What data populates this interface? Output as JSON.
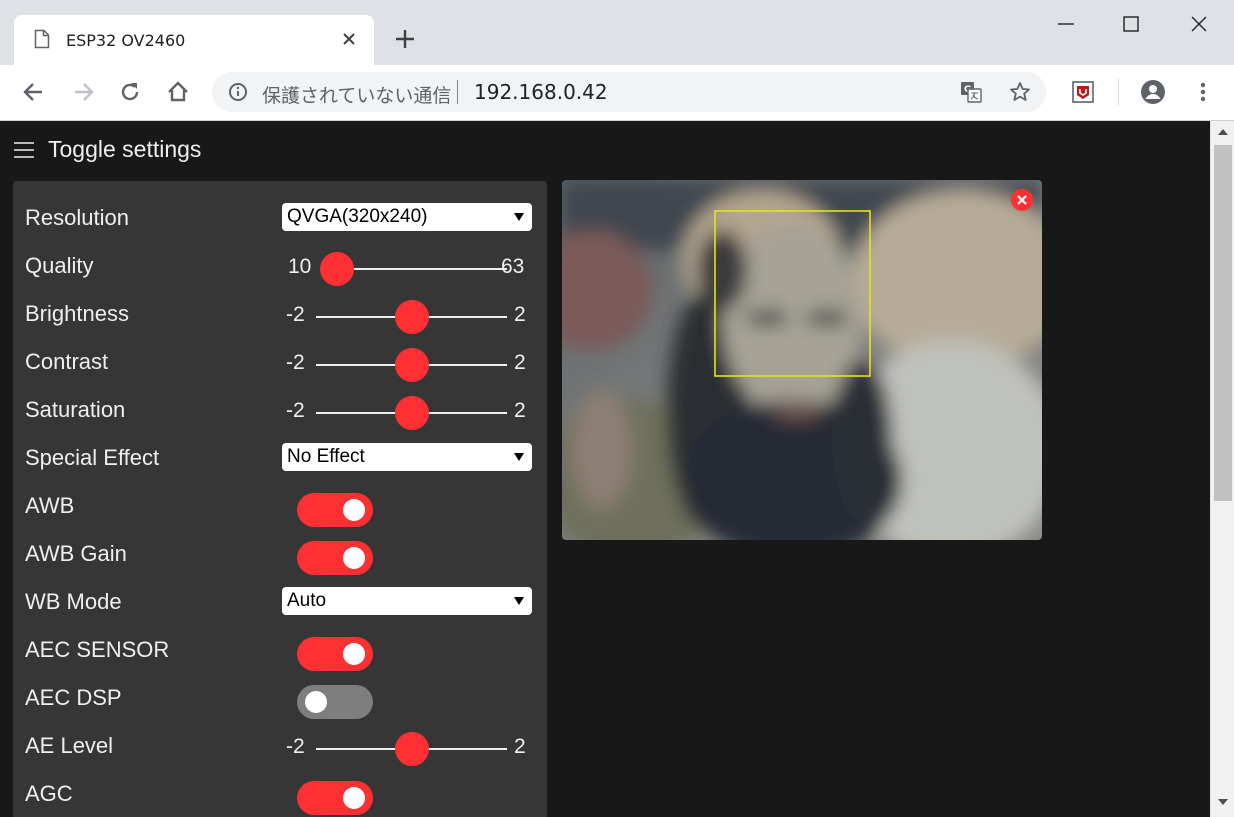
{
  "browser": {
    "tab_title": "ESP32 OV2460",
    "security_text": "保護されていない通信",
    "url": "192.168.0.42"
  },
  "page": {
    "toggle_label": "Toggle settings"
  },
  "settings": {
    "resolution": {
      "label": "Resolution",
      "value": "QVGA(320x240)"
    },
    "quality": {
      "label": "Quality",
      "min": "10",
      "max": "63",
      "value": 10
    },
    "brightness": {
      "label": "Brightness",
      "min": "-2",
      "max": "2",
      "value": 0
    },
    "contrast": {
      "label": "Contrast",
      "min": "-2",
      "max": "2",
      "value": 0
    },
    "saturation": {
      "label": "Saturation",
      "min": "-2",
      "max": "2",
      "value": 0
    },
    "special_effect": {
      "label": "Special Effect",
      "value": "No Effect"
    },
    "awb": {
      "label": "AWB",
      "on": true
    },
    "awb_gain": {
      "label": "AWB Gain",
      "on": true
    },
    "wb_mode": {
      "label": "WB Mode",
      "value": "Auto"
    },
    "aec_sensor": {
      "label": "AEC SENSOR",
      "on": true
    },
    "aec_dsp": {
      "label": "AEC DSP",
      "on": false
    },
    "ae_level": {
      "label": "AE Level",
      "min": "-2",
      "max": "2",
      "value": 0
    },
    "agc": {
      "label": "AGC",
      "on": true
    }
  },
  "colors": {
    "accent": "#ff3034",
    "panel": "#363636",
    "background": "#181818",
    "face_box": "#e5e21a"
  },
  "icons": [
    "page-icon",
    "close-icon",
    "plus-icon",
    "minimize-icon",
    "maximize-icon",
    "window-close-icon",
    "back-icon",
    "forward-icon",
    "reload-icon",
    "home-icon",
    "info-icon",
    "translate-icon",
    "star-icon",
    "extension-icon",
    "account-icon",
    "menu-icon",
    "hamburger-icon",
    "caret-down-icon",
    "close-stream-icon"
  ]
}
